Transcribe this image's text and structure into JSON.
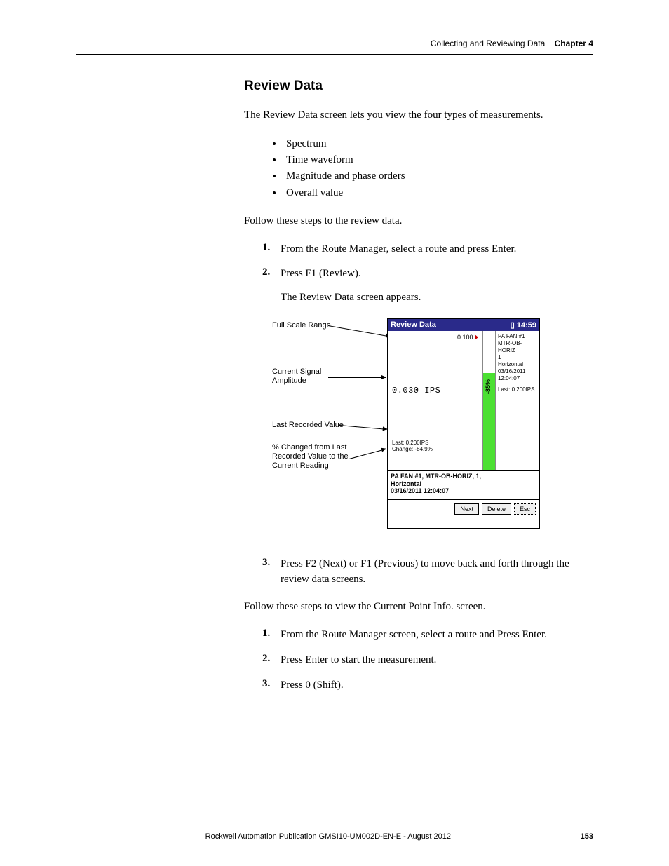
{
  "header": {
    "section": "Collecting and Reviewing Data",
    "chapter_label": "Chapter 4"
  },
  "title": "Review Data",
  "intro": "The Review Data screen lets you view the four types of measurements.",
  "bullets": [
    "Spectrum",
    "Time waveform",
    "Magnitude and phase orders",
    "Overall value"
  ],
  "steps_intro": "Follow these steps to the review data.",
  "steps1": [
    {
      "n": "1.",
      "text": "From the Route Manager, select a route and press Enter."
    },
    {
      "n": "2.",
      "text": "Press F1 (Review).",
      "sub": "The Review Data screen appears."
    }
  ],
  "callouts": {
    "c1": "Full Scale Range",
    "c2_a": "Current Signal",
    "c2_b": "Amplitude",
    "c3": "Last Recorded Value",
    "c4_a": "% Changed from Last",
    "c4_b": "Recorded Value to the",
    "c4_c": "Current Reading"
  },
  "device": {
    "title": "Review Data",
    "time": "14:59",
    "scale": "0.100",
    "amplitude": "0.030 IPS",
    "last": "Last: 0.200IPS",
    "change": "Change: -84.9%",
    "bar_pct": "-85%",
    "side": {
      "l1": "PA FAN #1",
      "l2": "MTR-OB-HORIZ",
      "l3": "1",
      "l4": "Horizontal",
      "l5": "03/16/2011",
      "l6": "12:04:07",
      "l7": "Last: 0.200IPS"
    },
    "info1": "PA FAN #1, MTR-OB-HORIZ, 1,",
    "info2": "Horizontal",
    "info3": "03/16/2011 12:04:07",
    "buttons": {
      "next": "Next",
      "delete": "Delete",
      "esc": "Esc"
    }
  },
  "step3": {
    "n": "3.",
    "text": "Press F2 (Next) or F1 (Previous) to move back and forth through the review data screens."
  },
  "steps2_intro": "Follow these steps to view the Current Point Info. screen.",
  "steps2": [
    {
      "n": "1.",
      "text": "From the Route Manager screen, select a route and Press Enter."
    },
    {
      "n": "2.",
      "text": "Press Enter to start the measurement."
    },
    {
      "n": "3.",
      "text": "Press 0 (Shift)."
    }
  ],
  "footer": {
    "publication": "Rockwell Automation Publication GMSI10-UM002D-EN-E - August 2012",
    "page": "153"
  }
}
